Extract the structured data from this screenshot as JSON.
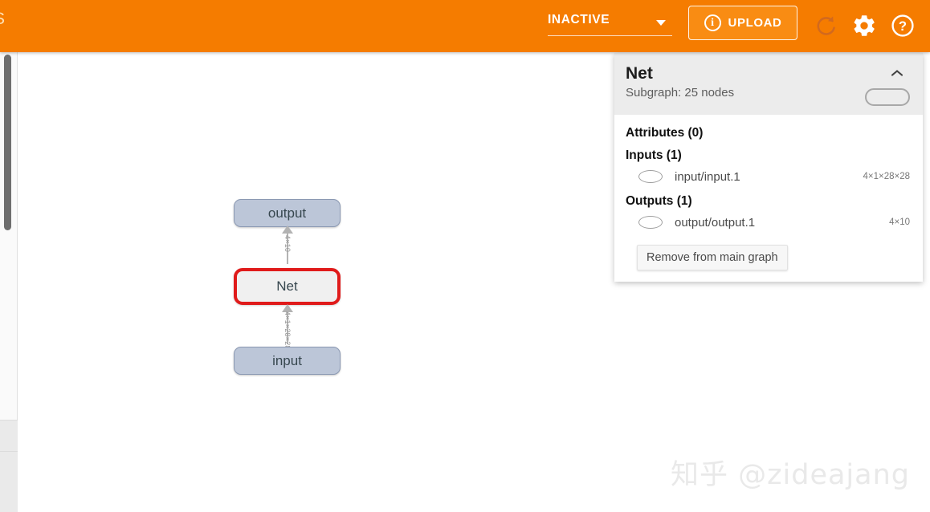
{
  "header": {
    "clipped_title": "S",
    "status": {
      "value": "INACTIVE",
      "caret_icon": "chevron-down-icon"
    },
    "upload": {
      "label": "UPLOAD",
      "info_icon": "info-circle-icon"
    },
    "icons": {
      "refresh": "refresh-icon",
      "settings": "gear-icon",
      "help": "help-circle-icon"
    },
    "background_color": "#f57c00"
  },
  "graph": {
    "nodes": [
      {
        "id": "output",
        "label": "output",
        "kind": "io"
      },
      {
        "id": "net",
        "label": "Net",
        "kind": "selected"
      },
      {
        "id": "input",
        "label": "input",
        "kind": "io"
      }
    ],
    "edges": [
      {
        "from": "net",
        "to": "output",
        "label": "4×10"
      },
      {
        "from": "input",
        "to": "net",
        "label": "4×1×28×28"
      }
    ],
    "selection_color": "#e01b1b",
    "io_node_color": "#bcc6d8"
  },
  "panel": {
    "title": "Net",
    "subtitle": "Subgraph: 25 nodes",
    "collapse_icon": "chevron-up-icon",
    "attributes": {
      "heading": "Attributes (0)"
    },
    "inputs": {
      "heading": "Inputs (1)",
      "rows": [
        {
          "icon": "ellipse-icon",
          "name": "input/input.1",
          "shape": "4×1×28×28"
        }
      ]
    },
    "outputs": {
      "heading": "Outputs (1)",
      "rows": [
        {
          "icon": "ellipse-icon",
          "name": "output/output.1",
          "shape": "4×10"
        }
      ]
    },
    "remove_button": "Remove from main graph"
  },
  "watermark": "知乎 @zideajang"
}
